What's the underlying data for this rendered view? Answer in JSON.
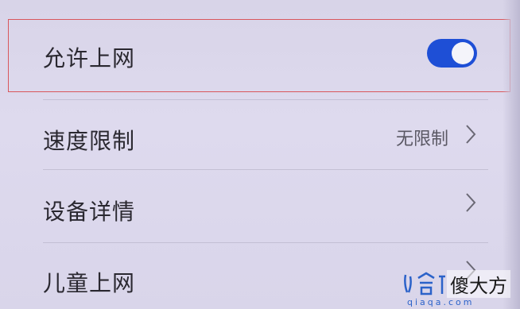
{
  "settings": {
    "items": [
      {
        "label": "允许上网",
        "toggle_on": true
      },
      {
        "label": "速度限制",
        "value": "无限制"
      },
      {
        "label": "设备详情"
      },
      {
        "label": "儿童上网"
      }
    ]
  },
  "colors": {
    "toggle_on": "#1e4fd6",
    "highlight_border": "#d9575c",
    "background": "#dcd8ea"
  },
  "watermark": {
    "name": "傻大方",
    "domain": "qiaqa.com"
  }
}
